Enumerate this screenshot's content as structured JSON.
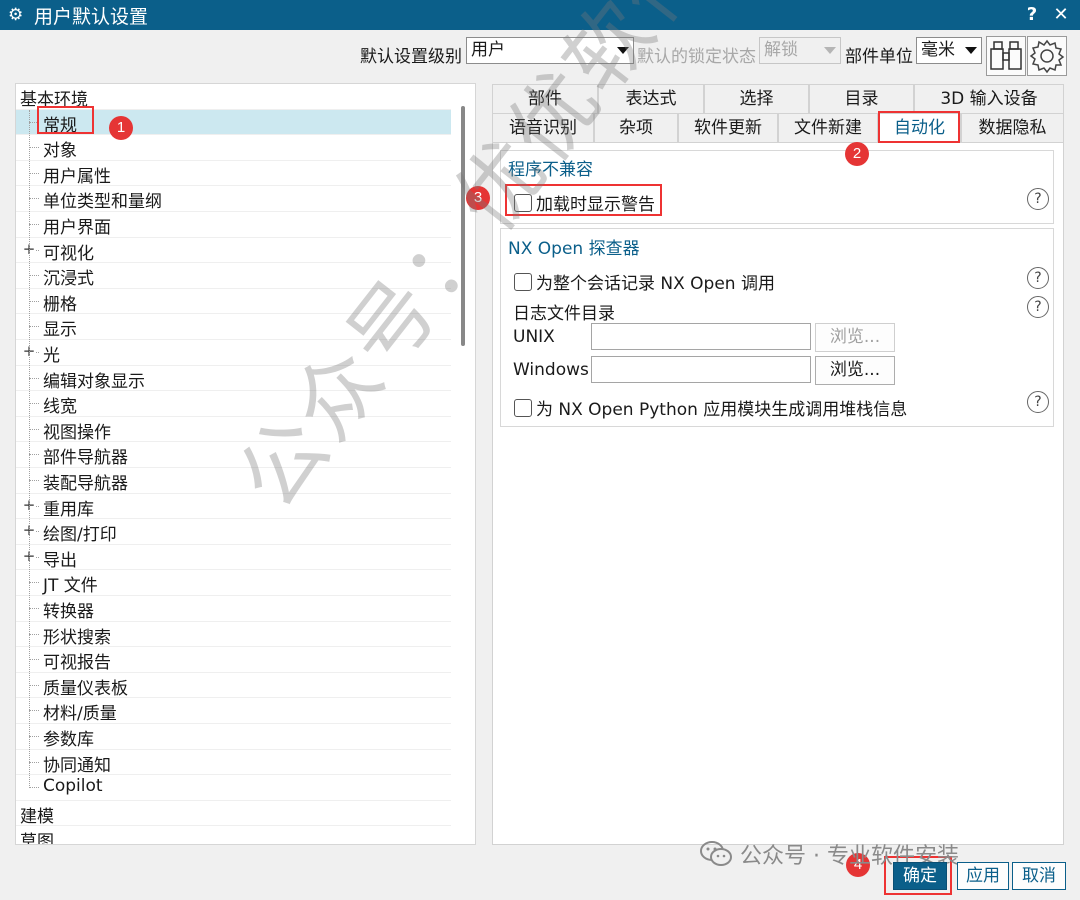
{
  "window": {
    "title": "用户默认设置",
    "help": "?",
    "close": "✕",
    "gear_icon": "gear-icon"
  },
  "toolbar": {
    "level_label": "默认设置级别",
    "level_value": "用户",
    "lock_label": "默认的锁定状态",
    "lock_value": "解锁",
    "unit_label": "部件单位",
    "unit_value": "毫米"
  },
  "tree": {
    "root_label": "基本环境",
    "items": [
      "常规",
      "对象",
      "用户属性",
      "单位类型和量纲",
      "用户界面",
      "可视化",
      "沉浸式",
      "栅格",
      "显示",
      "光",
      "编辑对象显示",
      "线宽",
      "视图操作",
      "部件导航器",
      "装配导航器",
      "重用库",
      "绘图/打印",
      "导出",
      "JT 文件",
      "转换器",
      "形状搜索",
      "可视报告",
      "质量仪表板",
      "材料/质量",
      "参数库",
      "协同通知",
      "Copilot"
    ],
    "after": [
      "建模",
      "草图"
    ]
  },
  "tabs": {
    "row1": [
      "部件",
      "表达式",
      "选择",
      "目录",
      "3D 输入设备"
    ],
    "row2": [
      "语音识别",
      "杂项",
      "软件更新",
      "文件新建",
      "自动化",
      "数据隐私"
    ]
  },
  "panel": {
    "group1_title": "程序不兼容",
    "warn_checkbox": "加载时显示警告",
    "group2_title": "NX Open 探查器",
    "record_checkbox": "为整个会话记录 NX Open 调用",
    "log_dir_label": "日志文件目录",
    "unix_label": "UNIX",
    "windows_label": "Windows",
    "browse": "浏览...",
    "python_checkbox": "为 NX Open Python 应用模块生成调用堆栈信息"
  },
  "help_glyph": "?",
  "badges": [
    "1",
    "2",
    "3",
    "4"
  ],
  "watermark": "公众号：优优软件安装",
  "watermark2": "公众号 · 专业软件安装",
  "buttons": {
    "ok": "确定",
    "apply": "应用",
    "cancel": "取消"
  },
  "colors": {
    "titlebar": "#0b5f8a",
    "accent": "#0b5f8a",
    "selection": "#cce8f0",
    "annotation": "#e53535"
  }
}
